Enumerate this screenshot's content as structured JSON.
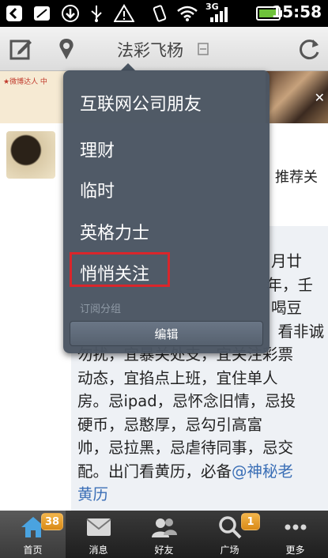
{
  "status_bar": {
    "time": "15:58",
    "network": "3G"
  },
  "title_bar": {
    "title": "法彩飞杨"
  },
  "feed": {
    "banner_text": "★微博达人 中",
    "recommend_label": "推荐关",
    "post_text_visible": "月廿 年，壬 喝豆 看非诚 勿扰，宜暴关处支，宜关注彩票动态，宜掐点上班，宜住单人房。忌ipad，忌怀念旧情，忌投硬币，忌憨厚，忌勾引高富帅，忌拉黑，忌虐待同事，忌交配。出门看黄历，必备",
    "post_lines": [
      "动态，宜掐点上班，宜住单人",
      "房。忌ipad，忌怀念旧情，忌投",
      "硬币，忌憨厚，忌勾引高富",
      "帅，忌拉黑，忌虐待同事，忌交",
      "配。出门看黄历，必备"
    ],
    "post_top_fragments": [
      "月廿",
      "年，壬",
      "喝豆",
      "看非诚",
      "勿扰，宜暴关处支，宜关注彩票"
    ],
    "mention": "@神秘老",
    "mention_2": "黄历"
  },
  "menu": {
    "items": [
      "互联网公司朋友",
      "理财",
      "临时",
      "英格力士",
      "悄悄关注"
    ],
    "section_label": "订阅分组",
    "edit_label": "编辑"
  },
  "tabbar": {
    "tabs": [
      {
        "label": "首页",
        "icon": "home-icon",
        "badge": "38"
      },
      {
        "label": "消息",
        "icon": "envelope-icon"
      },
      {
        "label": "好友",
        "icon": "friends-icon"
      },
      {
        "label": "广场",
        "icon": "magnifier-icon",
        "badge": "1"
      },
      {
        "label": "更多",
        "icon": "more-dots-icon"
      }
    ]
  },
  "colors": {
    "highlight": "#d9262b",
    "menu_bg": "#4a5562",
    "badge": "#e89a25",
    "link": "#3b6fb6"
  }
}
